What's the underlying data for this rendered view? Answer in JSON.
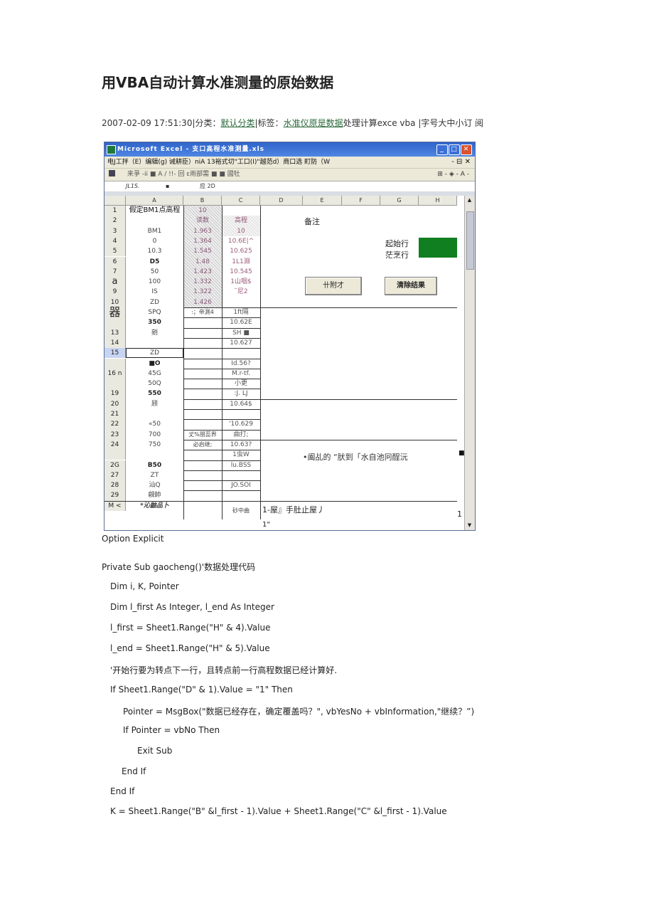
{
  "title": "用VBA自动计算水准测量的原始数据",
  "meta": {
    "datetime": "2007-02-09 17:51:30",
    "cat_label": "|分类：",
    "category": "默认分类",
    "tag_label": "|标签：",
    "tag_link": "水准仪原是数据",
    "tag_rest": "处理计算exce vba ",
    "font_size": "|字号大中小订  阅"
  },
  "excel": {
    "window_title": "Microsoft Excel - 支口高程水准测量.xls",
    "menu": "电J工拌（E）编辑(g)  诫耕臣）niA 13裕式切\"工口(I)\"越范d）商口选 町防（W",
    "toolbar": "来爭                    -ii ■ A / !!- 回 ε雨部需 ■ ■ 國牡",
    "name_box": "JL1S.",
    "formula": "应 2D",
    "columns": [
      "A",
      "B",
      "C",
      "D",
      "E",
      "F",
      "G",
      "H"
    ],
    "row_headers": [
      "1",
      "2",
      "3",
      "4",
      "5",
      "6",
      "7",
      "a",
      "9",
      "10",
      "器",
      "",
      "13",
      "14",
      "15",
      "",
      "16 n",
      "",
      "19",
      "20",
      "21",
      "22",
      "23",
      "24",
      "",
      "2G",
      "27",
      "28",
      "29",
      "M <"
    ],
    "col_a": [
      "假定BM1点高程",
      "",
      "BM1",
      "0",
      "10.3",
      "D5",
      "50",
      "100",
      "IS",
      "ZD",
      "SPQ",
      "350",
      "剜",
      "",
      "ZD",
      "■O",
      "45G",
      "50Q",
      "550",
      "顾",
      "",
      "«50",
      "700",
      "750",
      "",
      "B50",
      "ZT",
      "汕Q",
      "觎帥",
      "*沁鼬品卜"
    ],
    "col_b": [
      "10",
      "读数",
      "1.963",
      "1.364",
      "1.545",
      "1.48",
      "1.423",
      "1.332",
      "1.322",
      "1.426",
      ":；帝測4",
      "",
      "",
      "",
      "",
      "",
      "",
      "",
      "",
      "",
      "",
      "",
      "丈%朋蕊界",
      "必启继;",
      "",
      "",
      "",
      "",
      "",
      ""
    ],
    "col_c": [
      "",
      "高程",
      "10",
      "10.6E|^",
      "10.625",
      "1L1淵",
      "10.545",
      "1山咽$",
      "˜尼2",
      "",
      "1ft隔",
      "10.62E",
      "SH ■",
      "10.627",
      "",
      "Id.56?",
      "M.r-tf.",
      "小更",
      ":J. LJ",
      "10.64$",
      "",
      "'10.629",
      "曲打;",
      "10.63?",
      "1虫W",
      "lu.BSS",
      "",
      "JO.SOI",
      "",
      ""
    ],
    "bottom_c": "砂中曲",
    "bottom_d": "1-屋』手肚止屋丿",
    "bottom_d2": "1\"",
    "bottom_h": "1",
    "note_label": "备注",
    "start_label": "起始行",
    "end_label": "茫烹行",
    "calc_button": "卄附才",
    "clear_button": "清除结果",
    "side_note": "•阖乩的 “肰到「水自池冋酲沅"
  },
  "code_lines": [
    "Option Explicit",
    "Private Sub gaocheng()'数据处理代码",
    "Dim i, K, Pointer",
    "Dim l_first As Integer, l_end As Integer",
    "l_first = Sheet1.Range(\"H\" & 4).Value",
    "l_end = Sheet1.Range(\"H\" & 5).Value",
    "'开始行要为转点下一行，且转点前一行高程数据已经计算好.",
    "If Sheet1.Range(\"D\" & 1).Value = \"1\" Then",
    "Pointer = MsgBox(\"数据已经存在，确定覆盖吗？\", vbYesNo + vbInformation,\"继续？”)",
    "If Pointer = vbNo Then",
    "Exit Sub",
    "End If",
    "End If",
    "K = Sheet1.Range(\"B\" &l_first - 1).Value + Sheet1.Range(\"C\" &l_first - 1).Value"
  ],
  "colors": {
    "title_bar": "#2f63c9",
    "link": "#2a6a3a",
    "green_cell": "#0f7f1f"
  }
}
